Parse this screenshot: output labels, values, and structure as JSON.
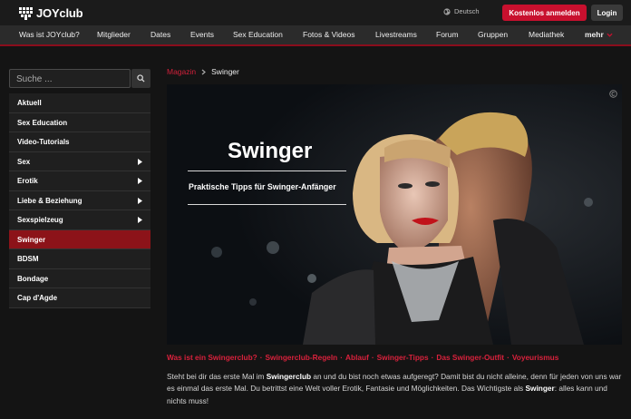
{
  "header": {
    "logo_text": "JOYclub",
    "language_label": "Deutsch",
    "register_label": "Kostenlos anmelden",
    "login_label": "Login"
  },
  "nav": {
    "items": [
      "Was ist JOYclub?",
      "Mitglieder",
      "Dates",
      "Events",
      "Sex Education",
      "Fotos & Videos",
      "Livestreams",
      "Forum",
      "Gruppen",
      "Mediathek"
    ],
    "more_label": "mehr"
  },
  "sidebar": {
    "search_placeholder": "Suche ...",
    "items": [
      {
        "label": "Aktuell",
        "has_arrow": false
      },
      {
        "label": "Sex Education",
        "has_arrow": false
      },
      {
        "label": "Video-Tutorials",
        "has_arrow": false
      },
      {
        "label": "Sex",
        "has_arrow": true
      },
      {
        "label": "Erotik",
        "has_arrow": true
      },
      {
        "label": "Liebe & Beziehung",
        "has_arrow": true
      },
      {
        "label": "Sexspielzeug",
        "has_arrow": true
      },
      {
        "label": "Swinger",
        "has_arrow": false,
        "active": true
      },
      {
        "label": "BDSM",
        "has_arrow": false
      },
      {
        "label": "Bondage",
        "has_arrow": false
      },
      {
        "label": "Cap d'Agde",
        "has_arrow": false
      }
    ]
  },
  "breadcrumb": {
    "parent": "Magazin",
    "current": "Swinger"
  },
  "hero": {
    "title": "Swinger",
    "subtitle": "Praktische Tipps für Swinger-Anfänger"
  },
  "tags": [
    "Was ist ein Swingerclub?",
    "Swingerclub-Regeln",
    "Ablauf",
    "Swinger-Tipps",
    "Das Swinger-Outfit",
    "Voyeurismus"
  ],
  "intro": {
    "part1": "Steht bei dir das erste Mal im ",
    "bold1": "Swingerclub",
    "part2": " an und du bist noch etwas aufgeregt? Damit bist du nicht alleine, denn für jeden von uns war es einmal das erste Mal. Du betrittst eine Welt voller Erotik, Fantasie und Möglichkeiten. Das Wichtigste als ",
    "bold2": "Swinger",
    "part3": ": alles kann und nichts muss!"
  },
  "colors": {
    "accent": "#c8102e",
    "active_item": "#8c1319",
    "link": "#d9213c"
  }
}
